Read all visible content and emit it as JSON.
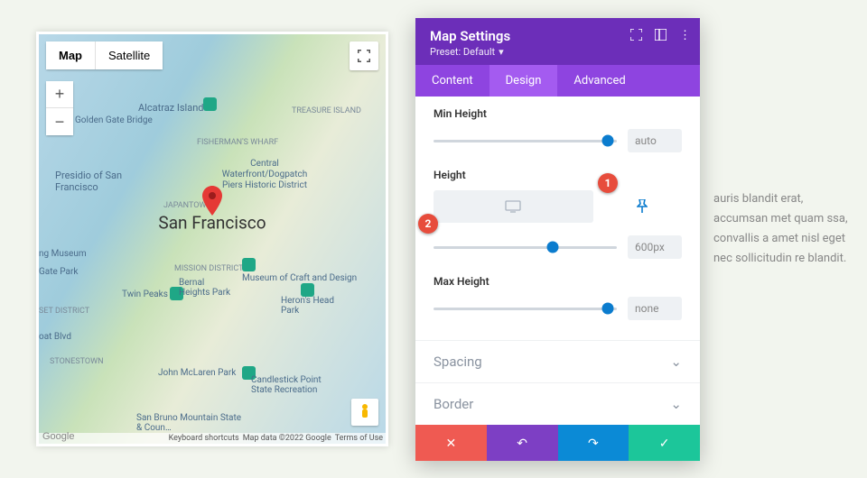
{
  "map": {
    "type_map": "Map",
    "type_satellite": "Satellite",
    "city": "San Francisco",
    "zoom_in": "+",
    "zoom_out": "−",
    "credits_shortcuts": "Keyboard shortcuts",
    "credits_data": "Map data ©2022 Google",
    "credits_terms": "Terms of Use",
    "credits_logo": "Google",
    "labels": {
      "alcatraz": "Alcatraz Island",
      "gg_bridge": "Golden Gate Bridge",
      "treasure": "TREASURE ISLAND",
      "fishermans": "FISHERMAN'S WHARF",
      "central": "Central Waterfront/Dogpatch Piers Historic District",
      "presidio": "Presidio of San Francisco",
      "japan": "JAPANTOWN",
      "mission": "MISSION DISTRICT",
      "craft": "Museum of Craft and Design",
      "twin": "Twin Peaks",
      "bernal": "Bernal Heights Park",
      "herons": "Heron's Head Park",
      "museum": "ng Museum",
      "gate": "Gate Park",
      "sunset": "SET DISTRICT",
      "blvd": "oat Blvd",
      "stone": "STONESTOWN",
      "mclaren": "John McLaren Park",
      "candlestick": "Candlestick Point State Recreation",
      "sanbruno": "San Bruno Mountain State & Coun…"
    }
  },
  "bg_text": "auris blandit erat, accumsan met quam ssa, convallis a amet nisl eget nec sollicitudin re blandit.",
  "panel": {
    "title": "Map Settings",
    "preset": "Preset: Default",
    "tabs": {
      "content": "Content",
      "design": "Design",
      "advanced": "Advanced"
    },
    "min_height": {
      "label": "Min Height",
      "value": "auto"
    },
    "height": {
      "label": "Height",
      "value": "600px"
    },
    "max_height": {
      "label": "Max Height",
      "value": "none"
    },
    "accordion": {
      "spacing": "Spacing",
      "border": "Border"
    }
  },
  "markers": {
    "m1": "1",
    "m2": "2"
  }
}
